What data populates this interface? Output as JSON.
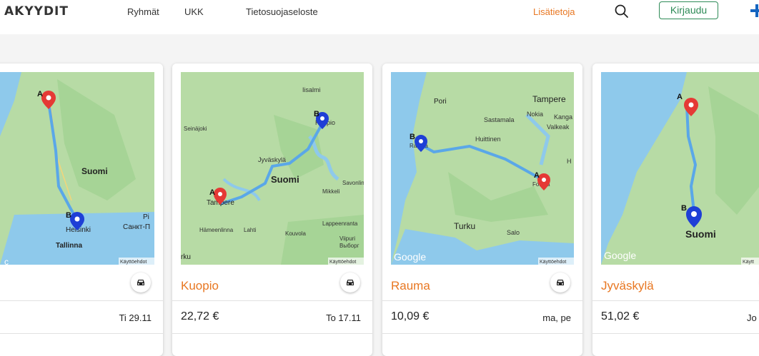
{
  "nav": {
    "logo": "AKYYDIT",
    "links": [
      "Ryhmät",
      "UKK",
      "Tietosuojaseloste"
    ],
    "more_link": "Lisätietoja",
    "login_label": "Kirjaudu",
    "search_icon": "search-icon",
    "plus_icon": "plus-icon"
  },
  "colors": {
    "accent": "#e87722",
    "login_green": "#2e8b57",
    "route_blue": "#4a90d9",
    "marker_a": "#e53935",
    "marker_b": "#1e3fd6"
  },
  "cards": [
    {
      "city": "nki",
      "price": "€",
      "date": "Ti 29.11",
      "map": {
        "labels": [
          "Suomi",
          "Helsinki",
          "Tallinna",
          "Pi",
          "Санкт-П"
        ],
        "attribution": "Käyttöehdot",
        "google": "c",
        "marker_a": "A",
        "marker_b": "B"
      }
    },
    {
      "city": "Kuopio",
      "price": "22,72 €",
      "date": "To 17.11",
      "map": {
        "labels": [
          "Iisalmi",
          "Seinäjoki",
          "Kuopio",
          "Jyväskylä",
          "Suomi",
          "Mikkeli",
          "Savonlin",
          "Tampere",
          "Hämeenlinna",
          "Lahti",
          "Kouvola",
          "Lappeenranta",
          "Viipuri",
          "Выборг",
          "rku"
        ],
        "attribution": "Käyttöehdot",
        "google": "",
        "marker_a": "A",
        "marker_b": "B"
      }
    },
    {
      "city": "Rauma",
      "price": "10,09 €",
      "date": "ma, pe",
      "map": {
        "labels": [
          "Pori",
          "Tampere",
          "Sastamala",
          "Nokia",
          "Kanga",
          "Valkeak",
          "Huittinen",
          "Rauma",
          "Forssa",
          "Turku",
          "Salo",
          "H"
        ],
        "attribution": "Käyttöehdot",
        "google": "Google",
        "marker_a": "A",
        "marker_b": "B"
      }
    },
    {
      "city": "Jyväskylä",
      "price": "51,02 €",
      "date": "Jo",
      "map": {
        "labels": [
          "Suomi"
        ],
        "attribution": "Käytt",
        "google": "Google",
        "marker_a": "A",
        "marker_b": "B"
      }
    }
  ]
}
